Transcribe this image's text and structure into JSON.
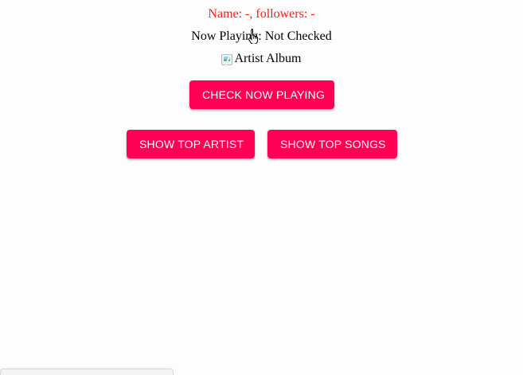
{
  "header": {
    "name_line": "Name: -, followers: -",
    "now_playing": "Now Playing: Not Checked"
  },
  "album": {
    "alt": "Artist Album",
    "icon": "broken-image-icon"
  },
  "buttons": {
    "check_now_playing": "CHECK NOW PLAYING",
    "show_top_artist": "SHOW TOP ARTIST",
    "show_top_songs": "SHOW TOP SONGS"
  },
  "colors": {
    "name_text": "#ff1a1a",
    "button_bg": "#ff0055",
    "button_text": "#ffffff"
  },
  "cursor": {
    "icon": "hand-pointer-icon"
  }
}
